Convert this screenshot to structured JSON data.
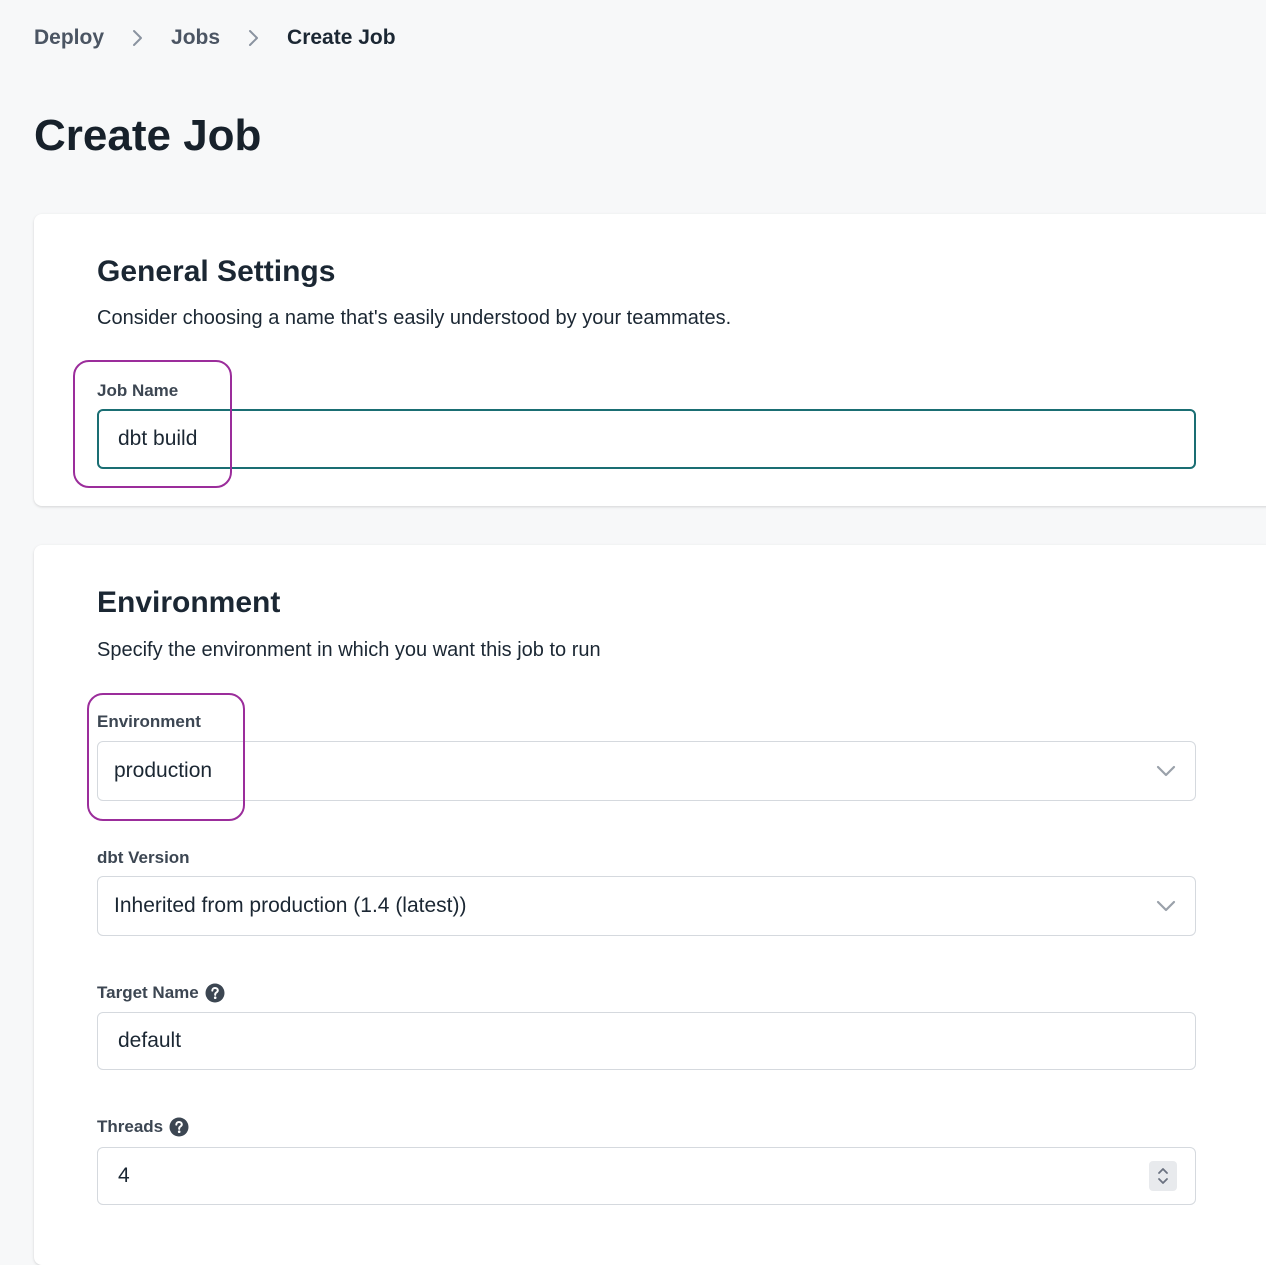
{
  "breadcrumb": {
    "items": [
      "Deploy",
      "Jobs",
      "Create Job"
    ]
  },
  "page": {
    "title": "Create Job"
  },
  "general_settings": {
    "title": "General Settings",
    "description": "Consider choosing a name that's easily understood by your teammates.",
    "job_name_label": "Job Name",
    "job_name_value": "dbt build"
  },
  "environment_section": {
    "title": "Environment",
    "description": "Specify the environment in which you want this job to run",
    "environment_label": "Environment",
    "environment_value": "production",
    "dbt_version_label": "dbt Version",
    "dbt_version_value": "Inherited from production (1.4 (latest))",
    "target_name_label": "Target Name",
    "target_name_value": "default",
    "threads_label": "Threads",
    "threads_value": "4"
  },
  "colors": {
    "focus_border": "#1a6e73",
    "highlight_annotation": "#9b2d9b",
    "page_background": "#f7f8f9"
  },
  "icons": [
    "chevron-right-icon",
    "chevron-down-icon",
    "help-circle-icon",
    "stepper-arrows-icon"
  ]
}
